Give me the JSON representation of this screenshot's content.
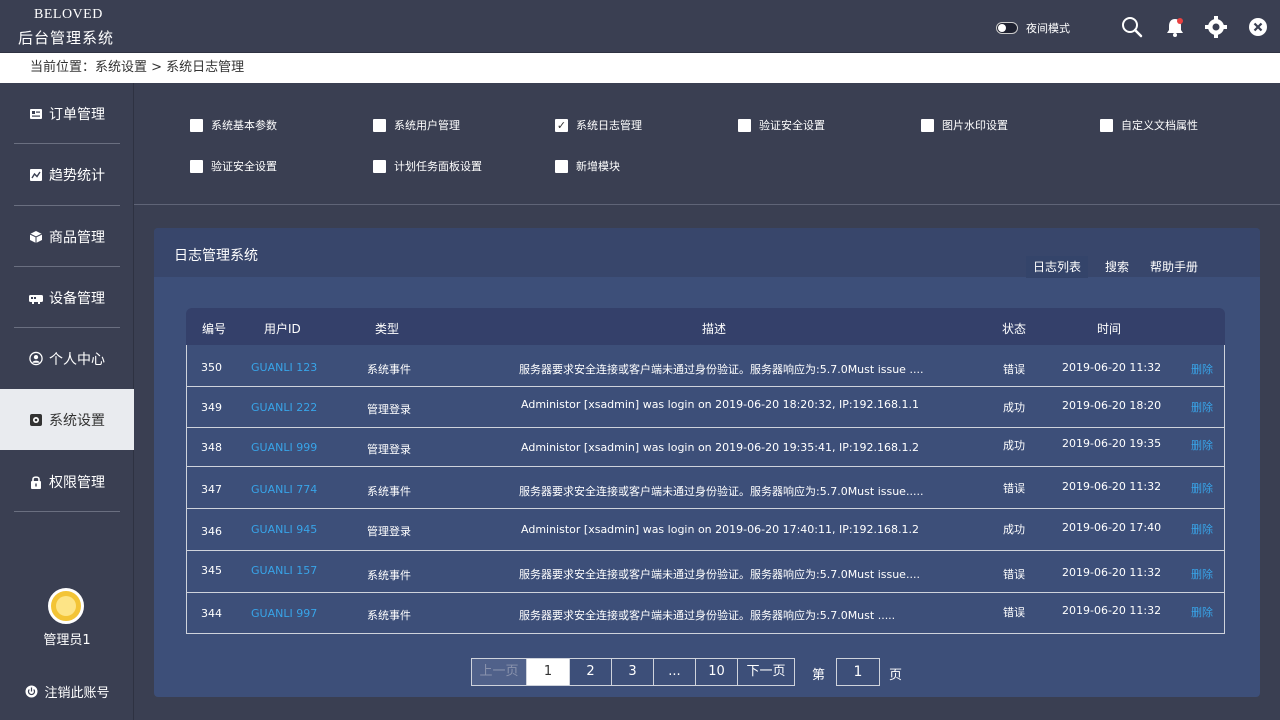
{
  "header": {
    "brand_en": "BELOVED",
    "brand_cn": "后台管理系统",
    "night_mode_label": "夜间模式"
  },
  "breadcrumb": "当前位置：系统设置 > 系统日志管理",
  "sidebar": {
    "items": [
      {
        "label": "订单管理",
        "icon": "order-icon"
      },
      {
        "label": "趋势统计",
        "icon": "chart-icon"
      },
      {
        "label": "商品管理",
        "icon": "box-icon"
      },
      {
        "label": "设备管理",
        "icon": "device-icon"
      },
      {
        "label": "个人中心",
        "icon": "user-icon"
      },
      {
        "label": "系统设置",
        "icon": "gear-icon",
        "active": true
      },
      {
        "label": "权限管理",
        "icon": "lock-icon"
      }
    ],
    "admin_name": "管理员1",
    "logout_label": "注销此账号"
  },
  "modules": [
    {
      "label": "系统基本参数",
      "checked": false
    },
    {
      "label": "系统用户管理",
      "checked": false
    },
    {
      "label": "系统日志管理",
      "checked": true
    },
    {
      "label": "验证安全设置",
      "checked": false
    },
    {
      "label": "图片水印设置",
      "checked": false
    },
    {
      "label": "自定义文档属性",
      "checked": false
    },
    {
      "label": "验证安全设置",
      "checked": false
    },
    {
      "label": "计划任务面板设置",
      "checked": false
    },
    {
      "label": "新增模块",
      "checked": false
    }
  ],
  "panel": {
    "title": "日志管理系统",
    "tabs": [
      "日志列表",
      "搜索",
      "帮助手册"
    ]
  },
  "table": {
    "headers": [
      "编号",
      "用户ID",
      "类型",
      "描述",
      "状态",
      "时间"
    ],
    "rows": [
      {
        "id": "350",
        "uid": "GUANLI 123",
        "type": "系统事件",
        "desc": "服务器要求安全连接或客户端未通过身份验证。服务器响应为:5.7.0Must issue ....",
        "status": "错误",
        "time": "2019-06-20 11:32",
        "action": "删除"
      },
      {
        "id": "349",
        "uid": "GUANLI 222",
        "type": "管理登录",
        "desc": "Administor [xsadmin] was login on 2019-06-20 18:20:32, IP:192.168.1.1",
        "status": "成功",
        "time": "2019-06-20 18:20",
        "action": "删除"
      },
      {
        "id": "348",
        "uid": "GUANLI 999",
        "type": "管理登录",
        "desc": "Administor [xsadmin] was login on 2019-06-20 19:35:41, IP:192.168.1.2",
        "status": "成功",
        "time": "2019-06-20 19:35",
        "action": "删除"
      },
      {
        "id": "347",
        "uid": "GUANLI 774",
        "type": "系统事件",
        "desc": "服务器要求安全连接或客户端未通过身份验证。服务器响应为:5.7.0Must issue.....",
        "status": "错误",
        "time": "2019-06-20 11:32",
        "action": "删除"
      },
      {
        "id": "346",
        "uid": "GUANLI 945",
        "type": "管理登录",
        "desc": "Administor [xsadmin] was login on 2019-06-20 17:40:11, IP:192.168.1.2",
        "status": "成功",
        "time": "2019-06-20 17:40",
        "action": "删除"
      },
      {
        "id": "345",
        "uid": "GUANLI 157",
        "type": "系统事件",
        "desc": "服务器要求安全连接或客户端未通过身份验证。服务器响应为:5.7.0Must issue....",
        "status": "错误",
        "time": "2019-06-20 11:32",
        "action": "删除"
      },
      {
        "id": "344",
        "uid": "GUANLI 997",
        "type": "系统事件",
        "desc": "服务器要求安全连接或客户端未通过身份验证。服务器响应为:5.7.0Must .....",
        "status": "错误",
        "time": "2019-06-20 11:32",
        "action": "删除"
      }
    ]
  },
  "pagination": {
    "prev": "上一页",
    "pages": [
      "1",
      "2",
      "3",
      "...",
      "10"
    ],
    "next": "下一页",
    "goto_prefix": "第",
    "goto_value": "1",
    "goto_suffix": "页"
  }
}
